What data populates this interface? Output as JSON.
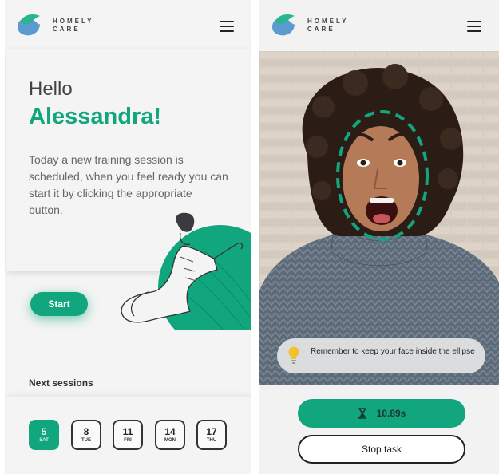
{
  "brand": {
    "line1": "HOMELY",
    "line2": "CARE"
  },
  "left": {
    "greeting": "Hello",
    "user_name": "Alessandra!",
    "intro_text": "Today a new training session is scheduled, when you feel ready you can start it by clicking the appropriate button.",
    "start_label": "Start",
    "next_sessions_title": "Next sessions",
    "sessions": [
      {
        "day": "5",
        "dow": "SAT"
      },
      {
        "day": "8",
        "dow": "TUE"
      },
      {
        "day": "11",
        "dow": "FRI"
      },
      {
        "day": "14",
        "dow": "MON"
      },
      {
        "day": "17",
        "dow": "THU"
      }
    ]
  },
  "right": {
    "tip_text": "Remember to keep your face inside the ellipse",
    "timer_label": "10.89s",
    "stop_label": "Stop task"
  },
  "icons": {
    "logo": "homely-care-logo-icon",
    "menu": "hamburger-menu-icon",
    "tip": "lightbulb-icon",
    "timer": "hourglass-icon"
  },
  "colors": {
    "accent": "#12a67e",
    "ellipse": "#12a67e",
    "bulb": "#f2c12e"
  }
}
